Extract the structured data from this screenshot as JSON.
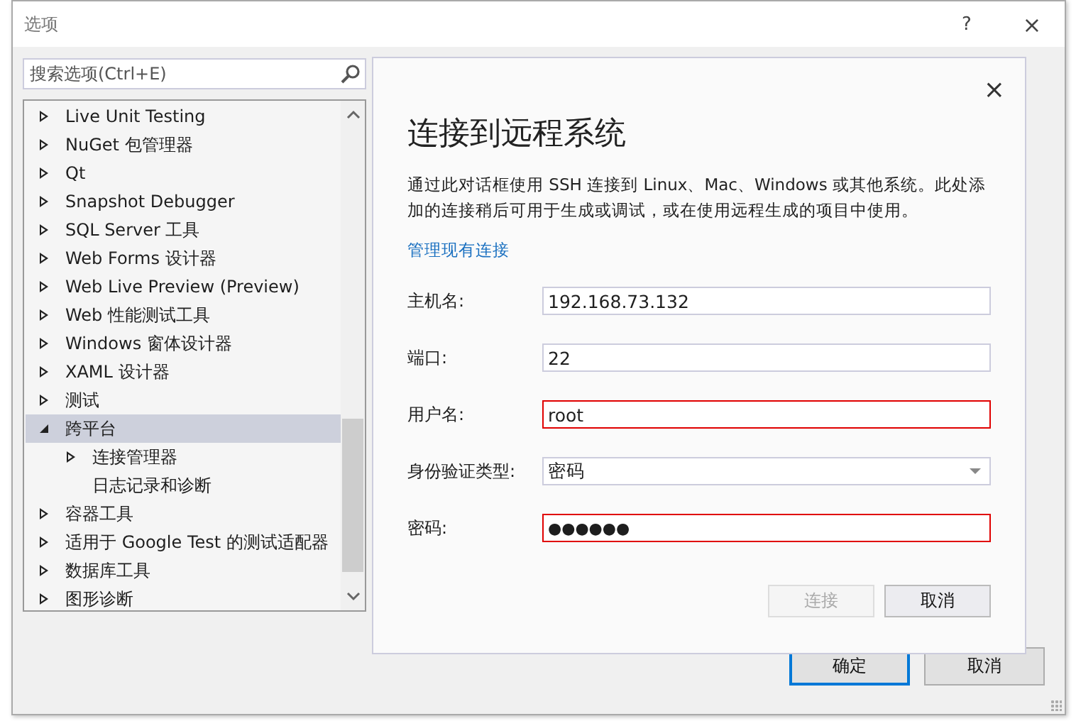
{
  "window": {
    "title": "选项",
    "help": "?",
    "close": "×"
  },
  "search": {
    "placeholder": "搜索选项(Ctrl+E)"
  },
  "tree": [
    {
      "label": "Live Unit Testing",
      "expanded": false,
      "selected": false
    },
    {
      "label": "NuGet 包管理器",
      "expanded": false,
      "selected": false
    },
    {
      "label": "Qt",
      "expanded": false,
      "selected": false
    },
    {
      "label": "Snapshot Debugger",
      "expanded": false,
      "selected": false
    },
    {
      "label": "SQL Server 工具",
      "expanded": false,
      "selected": false
    },
    {
      "label": "Web Forms 设计器",
      "expanded": false,
      "selected": false
    },
    {
      "label": "Web Live Preview (Preview)",
      "expanded": false,
      "selected": false
    },
    {
      "label": "Web 性能测试工具",
      "expanded": false,
      "selected": false
    },
    {
      "label": "Windows 窗体设计器",
      "expanded": false,
      "selected": false
    },
    {
      "label": "XAML 设计器",
      "expanded": false,
      "selected": false
    },
    {
      "label": "测试",
      "expanded": false,
      "selected": false
    },
    {
      "label": "跨平台",
      "expanded": true,
      "selected": true,
      "children": [
        {
          "label": "连接管理器",
          "expanded": false,
          "selected": false,
          "expandable": true
        },
        {
          "label": "日志记录和诊断",
          "selected": false,
          "expandable": false
        }
      ]
    },
    {
      "label": "容器工具",
      "expanded": false,
      "selected": false
    },
    {
      "label": "适用于 Google Test 的测试适配器",
      "expanded": false,
      "selected": false
    },
    {
      "label": "数据库工具",
      "expanded": false,
      "selected": false
    },
    {
      "label": "图形诊断",
      "expanded": false,
      "selected": false
    }
  ],
  "dialog": {
    "close": "×",
    "title": "连接到远程系统",
    "description": "通过此对话框使用 SSH 连接到 Linux、Mac、Windows 或其他系统。此处添加的连接稍后可用于生成或调试，或在使用远程生成的项目中使用。",
    "link": "管理现有连接",
    "fields": [
      {
        "label": "主机名:",
        "kind": "text",
        "value": "192.168.73.132",
        "error": false
      },
      {
        "label": "端口:",
        "kind": "text",
        "value": "22",
        "error": false
      },
      {
        "label": "用户名:",
        "kind": "text",
        "value": "root",
        "error": true
      },
      {
        "label": "身份验证类型:",
        "kind": "select",
        "value": "密码",
        "error": false
      },
      {
        "label": "密码:",
        "kind": "password",
        "value": "●●●●●●",
        "error": true
      }
    ],
    "buttons": [
      {
        "label": "连接",
        "disabled": true
      },
      {
        "label": "取消",
        "disabled": false
      }
    ]
  },
  "footer_buttons": [
    {
      "label": "确定",
      "default": true
    },
    {
      "label": "取消",
      "default": false
    }
  ]
}
